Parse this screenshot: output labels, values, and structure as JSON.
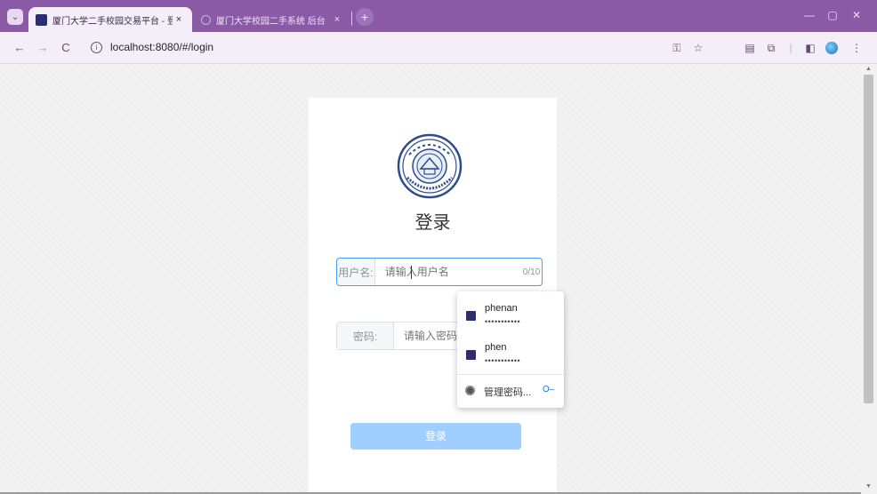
{
  "browser": {
    "tabs": [
      {
        "title": "厦门大学二手校园交易平台 - 登",
        "active": true
      },
      {
        "title": "厦门大学校园二手系统 后台",
        "active": false
      }
    ],
    "tab_close": "×",
    "new_tab": "+",
    "menu_icon": "chevron-down-icon",
    "window_controls": {
      "minimize": "—",
      "restore": "▢",
      "close": "✕"
    },
    "nav": {
      "back": "←",
      "forward": "→",
      "reload": "C"
    },
    "url": "localhost:8080/#/login",
    "toolbar_icons": {
      "passwords": "key-icon",
      "bookmark": "☆",
      "reading": "▤",
      "extensions": "⧉",
      "sidepanel": "◧",
      "profile": "avatar",
      "menu": "⋮"
    }
  },
  "login": {
    "title": "登录",
    "username_label": "用户名:",
    "username_placeholder": "请输入用户名",
    "username_counter": "0/10",
    "password_label": "密码:",
    "password_placeholder": "请输入密码",
    "submit": "登录"
  },
  "autofill": {
    "accounts": [
      {
        "username": "phenan",
        "password_mask": "•••••••••••"
      },
      {
        "username": "phen",
        "password_mask": "•••••••••••"
      }
    ],
    "manage_label": "管理密码...",
    "manage_icon": "key-icon"
  },
  "colors": {
    "titlebar": "#8a5aa7",
    "primary": "#409eff",
    "button_disabled": "#a0cfff"
  }
}
